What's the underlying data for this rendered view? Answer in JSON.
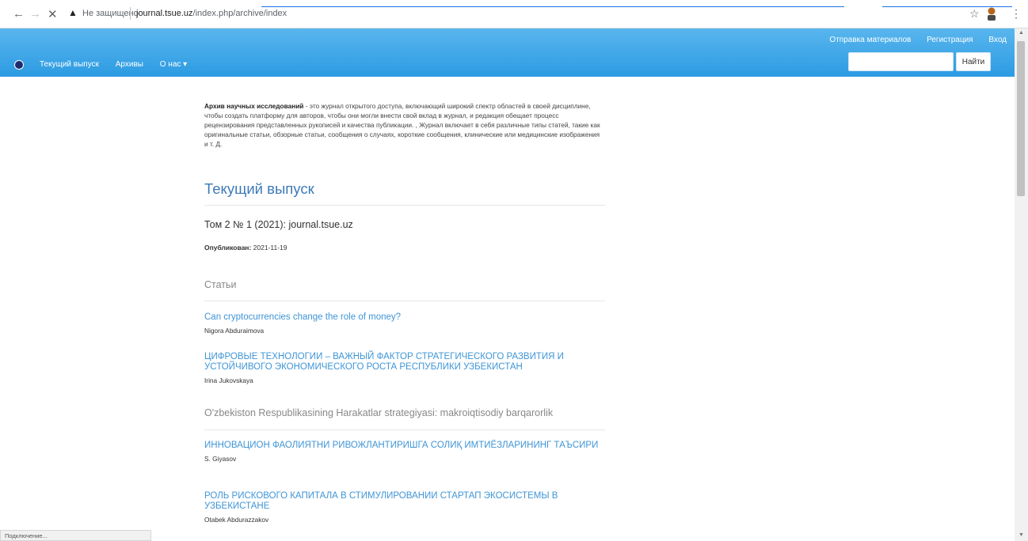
{
  "browser": {
    "back_icon": "arrow-left-icon",
    "forward_icon": "arrow-right-icon",
    "stop_icon": "close-icon",
    "security_label": "Не защищено",
    "url_host": "journal.tsue.uz",
    "url_path": "/index.php/archive/index",
    "status_text": "Подключение..."
  },
  "header": {
    "top_links": [
      "Отправка материалов",
      "Регистрация",
      "Вход"
    ],
    "nav": [
      "Текущий выпуск",
      "Архивы",
      "О нас ▾"
    ],
    "search_placeholder": "",
    "search_button": "Найти"
  },
  "about": {
    "bold_lead": "Архив научных исследований",
    "text": " - это журнал открытого доступа, включающий широкий спектр областей в своей дисциплине, чтобы создать платформу для авторов, чтобы они могли внести свой вклад в журнал, и редакция обещает процесс рецензирования представленных рукописей и качества публикации. , Журнал включает в себя различные типы статей, такие как оригинальные статьи, обзорные статьи, сообщения о случаях, короткие сообщения, клинические или медицинские изображения и т. Д."
  },
  "current_issue": {
    "heading": "Текущий выпуск",
    "title": "Том 2 № 1 (2021): journal.tsue.uz",
    "published_label": "Опубликован:",
    "published_date": "2021-11-19",
    "articles_heading": "Статьи"
  },
  "articles": [
    {
      "title": "Can cryptocurrencies change the role of money?",
      "author": "Nigora Abduraimova"
    },
    {
      "title": "ЦИФРОВЫЕ ТЕХНОЛОГИИ – ВАЖНЫЙ ФАКТОР СТРАТЕГИЧЕСКОГО РАЗВИТИЯ И УСТОЙЧИВОГО ЭКОНОМИЧЕСКОГО РОСТА РЕСПУБЛИКИ УЗБЕКИСТАН",
      "author": "Irina Jukovskaya"
    },
    {
      "title": "O'zbekiston Respublikasining Harakatlar strategiyasi: makroiqtisodiy barqarorlik",
      "author": ""
    },
    {
      "title": "ИННОВАЦИОН ФАОЛИЯТНИ РИВОЖЛАНТИРИШГА СОЛИҚ ИМТИЁЗЛАРИНИНГ ТАЪСИРИ",
      "author": "S. Giyasov"
    },
    {
      "title": "РОЛЬ РИСКОВОГО КАПИТАЛА В СТИМУЛИРОВАНИИ СТАРТАП ЭКОСИСТЕМЫ В УЗБЕКИСТАНЕ",
      "author": "Otabek Abdurazzakov"
    }
  ]
}
